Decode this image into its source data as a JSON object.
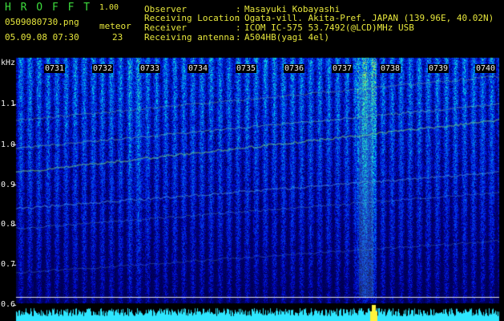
{
  "header": {
    "logo_text": "H R O F F T",
    "version": "1.00",
    "filename": "0509080730.png",
    "datetime": "05.09.08 07:30",
    "meteor_label": "meteor",
    "meteor_count": "23"
  },
  "info": [
    {
      "label": "Observer",
      "sep": ":",
      "value": "Masayuki Kobayashi"
    },
    {
      "label": "Receiving Location",
      "sep": ":",
      "value": "Ogata-vill. Akita-Pref. JAPAN (139.96E, 40.02N)"
    },
    {
      "label": "Receiver",
      "sep": ":",
      "value": "ICOM IC-575 53.7492(@LCD)MHz USB"
    },
    {
      "label": "Receiving antenna",
      "sep": ":",
      "value": "A504HB(yagi 4el)"
    }
  ],
  "axis": {
    "unit": "kHz",
    "freq_labels": [
      "1.1",
      "1.0",
      "0.9",
      "0.8",
      "0.7",
      "0.6"
    ],
    "time_labels": [
      "0731",
      "0732",
      "0733",
      "0734",
      "0735",
      "0736",
      "0737",
      "0738",
      "0739",
      "0740"
    ]
  },
  "colors": {
    "header_yellow": "#e6e63c",
    "header_green": "#3ddc3d",
    "spectrum_bars": "#2ee6ff",
    "peak": "#fff23c"
  }
}
